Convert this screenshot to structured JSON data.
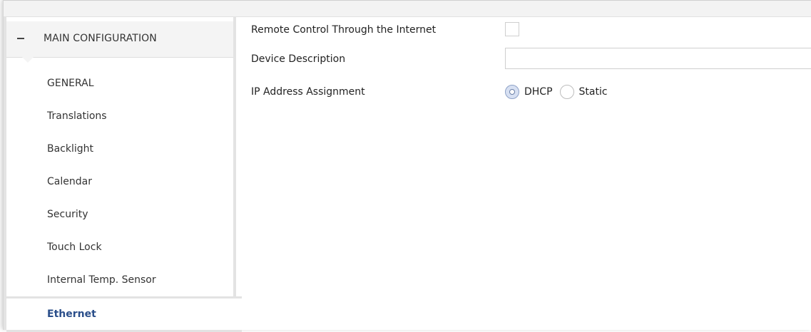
{
  "sidebar": {
    "section_title": "MAIN CONFIGURATION",
    "items": [
      {
        "label": "GENERAL"
      },
      {
        "label": "Translations"
      },
      {
        "label": "Backlight"
      },
      {
        "label": "Calendar"
      },
      {
        "label": "Security"
      },
      {
        "label": "Touch Lock"
      },
      {
        "label": "Internal Temp. Sensor"
      },
      {
        "label": "Ethernet"
      }
    ],
    "active_item": "Ethernet"
  },
  "form": {
    "remote_control_label": "Remote Control Through the Internet",
    "remote_control_checked": false,
    "device_description_label": "Device Description",
    "device_description_value": "",
    "ip_assignment_label": "IP Address Assignment",
    "ip_options": [
      {
        "label": "DHCP",
        "selected": true
      },
      {
        "label": "Static",
        "selected": false
      }
    ]
  },
  "colors": {
    "active_text": "#2a4e8a",
    "sidebar_border": "#e3e3e3",
    "header_bg": "#f4f4f4"
  },
  "icons": {
    "collapse": "minus-icon"
  }
}
